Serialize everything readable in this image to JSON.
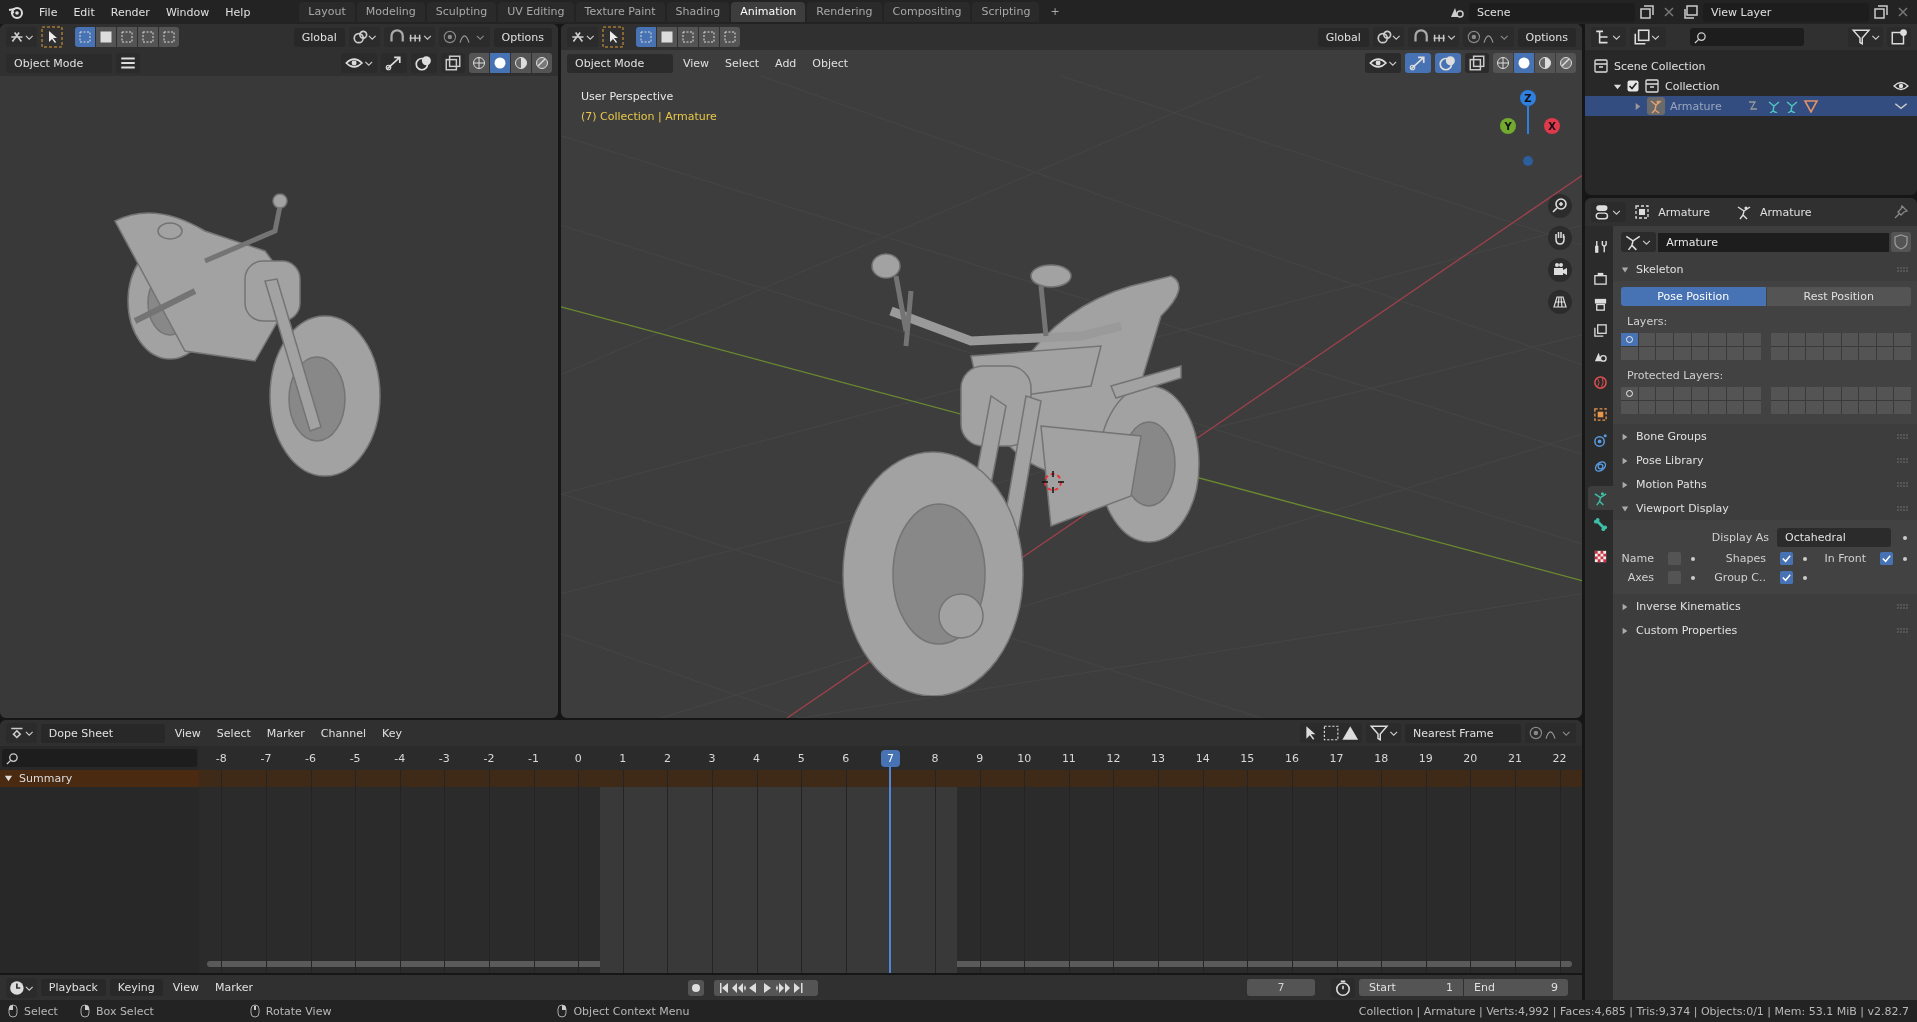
{
  "top_bar": {
    "menus": [
      "File",
      "Edit",
      "Render",
      "Window",
      "Help"
    ],
    "workspaces": [
      {
        "label": "Layout",
        "selected": false
      },
      {
        "label": "Modeling",
        "selected": false
      },
      {
        "label": "Sculpting",
        "selected": false
      },
      {
        "label": "UV Editing",
        "selected": false
      },
      {
        "label": "Texture Paint",
        "selected": false
      },
      {
        "label": "Shading",
        "selected": false
      },
      {
        "label": "Animation",
        "selected": true
      },
      {
        "label": "Rendering",
        "selected": false
      },
      {
        "label": "Compositing",
        "selected": false
      },
      {
        "label": "Scripting",
        "selected": false
      }
    ],
    "add_tab": "+",
    "scene": "Scene",
    "view_layer": "View Layer"
  },
  "side_viewport": {
    "orientation": "Global",
    "options": "Options",
    "mode": "Object Mode",
    "select_modes": [
      {
        "selected": true
      },
      {
        "selected": false
      },
      {
        "selected": false
      },
      {
        "selected": false
      },
      {
        "selected": false
      }
    ],
    "shading": [
      {
        "kind": "wireframe",
        "selected": false
      },
      {
        "kind": "solid",
        "selected": true
      },
      {
        "kind": "material",
        "selected": false
      },
      {
        "kind": "rendered",
        "selected": false
      }
    ],
    "gizmos_on": false,
    "overlays_on": false
  },
  "main_viewport": {
    "mode": "Object Mode",
    "menus": [
      "View",
      "Select",
      "Add",
      "Object"
    ],
    "orientation": "Global",
    "options": "Options",
    "select_modes": [
      {
        "selected": true
      },
      {
        "selected": false
      },
      {
        "selected": false
      },
      {
        "selected": false
      },
      {
        "selected": false
      }
    ],
    "shading": [
      {
        "kind": "wireframe",
        "selected": false
      },
      {
        "kind": "solid",
        "selected": true
      },
      {
        "kind": "material",
        "selected": false
      },
      {
        "kind": "rendered",
        "selected": false
      }
    ],
    "gizmos_on": true,
    "overlays_on": true,
    "perspective": "User Perspective",
    "context": "(7) Collection | Armature",
    "gizmo": [
      {
        "label": "Z",
        "color": "#2f7fe0"
      },
      {
        "label": "Y",
        "color": "#72a92f"
      },
      {
        "label": "X",
        "color": "#e0394c"
      }
    ]
  },
  "outliner": {
    "items": [
      {
        "label": "Scene Collection",
        "kind": "scene",
        "children": [
          {
            "label": "Collection",
            "kind": "collection",
            "checked": true,
            "expanded": true,
            "children": [
              {
                "label": "Armature",
                "kind": "armature",
                "selected": true,
                "expanded": false
              }
            ]
          }
        ]
      }
    ]
  },
  "properties": {
    "object": "Armature",
    "data": "Armature",
    "datablock": "Armature",
    "tabs": [
      {
        "kind": "tool",
        "selected": false
      },
      {
        "kind": "render",
        "selected": false
      },
      {
        "kind": "output",
        "selected": false
      },
      {
        "kind": "view-layer",
        "selected": false
      },
      {
        "kind": "scene",
        "selected": false
      },
      {
        "kind": "world",
        "selected": false
      },
      {
        "kind": "object",
        "selected": false
      },
      {
        "kind": "physics",
        "selected": false
      },
      {
        "kind": "constraints",
        "selected": false
      },
      {
        "kind": "data",
        "selected": true
      },
      {
        "kind": "bone",
        "selected": false
      },
      {
        "kind": "texture",
        "selected": false
      }
    ],
    "panels": [
      {
        "title": "Skeleton",
        "kind": "skeleton",
        "expanded": true,
        "positions": [
          {
            "label": "Pose Position",
            "selected": true
          },
          {
            "label": "Rest Position",
            "selected": false
          }
        ],
        "layers_label": "Layers:",
        "layers": [
          {
            "on": true,
            "used": true
          },
          {
            "on": false,
            "used": false
          },
          {
            "on": false,
            "used": false
          },
          {
            "on": false,
            "used": false
          },
          {
            "on": false,
            "used": false
          },
          {
            "on": false,
            "used": false
          },
          {
            "on": false,
            "used": false
          },
          {
            "on": false,
            "used": false
          },
          {
            "on": false,
            "used": false
          },
          {
            "on": false,
            "used": false
          },
          {
            "on": false,
            "used": false
          },
          {
            "on": false,
            "used": false
          },
          {
            "on": false,
            "used": false
          },
          {
            "on": false,
            "used": false
          },
          {
            "on": false,
            "used": false
          },
          {
            "on": false,
            "used": false
          },
          {
            "on": false,
            "used": false
          },
          {
            "on": false,
            "used": false
          },
          {
            "on": false,
            "used": false
          },
          {
            "on": false,
            "used": false
          },
          {
            "on": false,
            "used": false
          },
          {
            "on": false,
            "used": false
          },
          {
            "on": false,
            "used": false
          },
          {
            "on": false,
            "used": false
          },
          {
            "on": false,
            "used": false
          },
          {
            "on": false,
            "used": false
          },
          {
            "on": false,
            "used": false
          },
          {
            "on": false,
            "used": false
          },
          {
            "on": false,
            "used": false
          },
          {
            "on": false,
            "used": false
          },
          {
            "on": false,
            "used": false
          },
          {
            "on": false,
            "used": false
          }
        ],
        "protected_label": "Protected Layers:",
        "protected_layers": [
          {
            "on": false,
            "used": true
          },
          {
            "on": false,
            "used": false
          },
          {
            "on": false,
            "used": false
          },
          {
            "on": false,
            "used": false
          },
          {
            "on": false,
            "used": false
          },
          {
            "on": false,
            "used": false
          },
          {
            "on": false,
            "used": false
          },
          {
            "on": false,
            "used": false
          },
          {
            "on": false,
            "used": false
          },
          {
            "on": false,
            "used": false
          },
          {
            "on": false,
            "used": false
          },
          {
            "on": false,
            "used": false
          },
          {
            "on": false,
            "used": false
          },
          {
            "on": false,
            "used": false
          },
          {
            "on": false,
            "used": false
          },
          {
            "on": false,
            "used": false
          },
          {
            "on": false,
            "used": false
          },
          {
            "on": false,
            "used": false
          },
          {
            "on": false,
            "used": false
          },
          {
            "on": false,
            "used": false
          },
          {
            "on": false,
            "used": false
          },
          {
            "on": false,
            "used": false
          },
          {
            "on": false,
            "used": false
          },
          {
            "on": false,
            "used": false
          },
          {
            "on": false,
            "used": false
          },
          {
            "on": false,
            "used": false
          },
          {
            "on": false,
            "used": false
          },
          {
            "on": false,
            "used": false
          },
          {
            "on": false,
            "used": false
          },
          {
            "on": false,
            "used": false
          },
          {
            "on": false,
            "used": false
          },
          {
            "on": false,
            "used": false
          }
        ]
      },
      {
        "title": "Bone Groups",
        "kind": "plain",
        "expanded": false
      },
      {
        "title": "Pose Library",
        "kind": "plain",
        "expanded": false
      },
      {
        "title": "Motion Paths",
        "kind": "plain",
        "expanded": false
      },
      {
        "title": "Viewport Display",
        "kind": "display",
        "expanded": true,
        "display_as_label": "Display As",
        "display_as": "Octahedral",
        "checkboxes": [
          {
            "label": "Name",
            "checked": false
          },
          {
            "label": "Shapes",
            "checked": true
          },
          {
            "label": "In Front",
            "checked": true
          },
          {
            "label": "Axes",
            "checked": false
          },
          {
            "label": "Group C..",
            "checked": true
          }
        ]
      },
      {
        "title": "Inverse Kinematics",
        "kind": "plain",
        "expanded": false
      },
      {
        "title": "Custom Properties",
        "kind": "plain",
        "expanded": false
      }
    ]
  },
  "dope_sheet": {
    "editor": "Dope Sheet",
    "menus": [
      "View",
      "Select",
      "Marker",
      "Channel",
      "Key"
    ],
    "snap": "Nearest Frame",
    "channels": [
      {
        "label": "Summary",
        "expanded": true
      }
    ],
    "frames": [
      {
        "label": "-8",
        "in_range": false,
        "current": false
      },
      {
        "label": "-7",
        "in_range": false,
        "current": false
      },
      {
        "label": "-6",
        "in_range": false,
        "current": false
      },
      {
        "label": "-5",
        "in_range": false,
        "current": false
      },
      {
        "label": "-4",
        "in_range": false,
        "current": false
      },
      {
        "label": "-3",
        "in_range": false,
        "current": false
      },
      {
        "label": "-2",
        "in_range": false,
        "current": false
      },
      {
        "label": "-1",
        "in_range": false,
        "current": false
      },
      {
        "label": "0",
        "in_range": false,
        "current": false
      },
      {
        "label": "1",
        "in_range": true,
        "current": false
      },
      {
        "label": "2",
        "in_range": true,
        "current": false
      },
      {
        "label": "3",
        "in_range": true,
        "current": false
      },
      {
        "label": "4",
        "in_range": true,
        "current": false
      },
      {
        "label": "5",
        "in_range": true,
        "current": false
      },
      {
        "label": "6",
        "in_range": true,
        "current": false
      },
      {
        "label": "7",
        "in_range": true,
        "current": true
      },
      {
        "label": "8",
        "in_range": true,
        "current": false
      },
      {
        "label": "9",
        "in_range": false,
        "current": false
      },
      {
        "label": "10",
        "in_range": false,
        "current": false
      },
      {
        "label": "11",
        "in_range": false,
        "current": false
      },
      {
        "label": "12",
        "in_range": false,
        "current": false
      },
      {
        "label": "13",
        "in_range": false,
        "current": false
      },
      {
        "label": "14",
        "in_range": false,
        "current": false
      },
      {
        "label": "15",
        "in_range": false,
        "current": false
      },
      {
        "label": "16",
        "in_range": false,
        "current": false
      },
      {
        "label": "17",
        "in_range": false,
        "current": false
      },
      {
        "label": "18",
        "in_range": false,
        "current": false
      },
      {
        "label": "19",
        "in_range": false,
        "current": false
      },
      {
        "label": "20",
        "in_range": false,
        "current": false
      },
      {
        "label": "21",
        "in_range": false,
        "current": false
      },
      {
        "label": "22",
        "in_range": false,
        "current": false
      }
    ]
  },
  "timeline": {
    "dropdowns": [
      "Playback",
      "Keying"
    ],
    "menus": [
      "View",
      "Marker"
    ],
    "current_frame": "7",
    "start_label": "Start",
    "start": "1",
    "end_label": "End",
    "end": "9"
  },
  "status_bar": {
    "hints": [
      "Select",
      "Box Select",
      "Rotate View",
      "Object Context Menu"
    ],
    "stats": "Collection | Armature | Verts:4,992 | Faces:4,685 | Tris:9,374 | Objects:0/1 | Mem: 53.1 MiB | v2.82.7"
  }
}
